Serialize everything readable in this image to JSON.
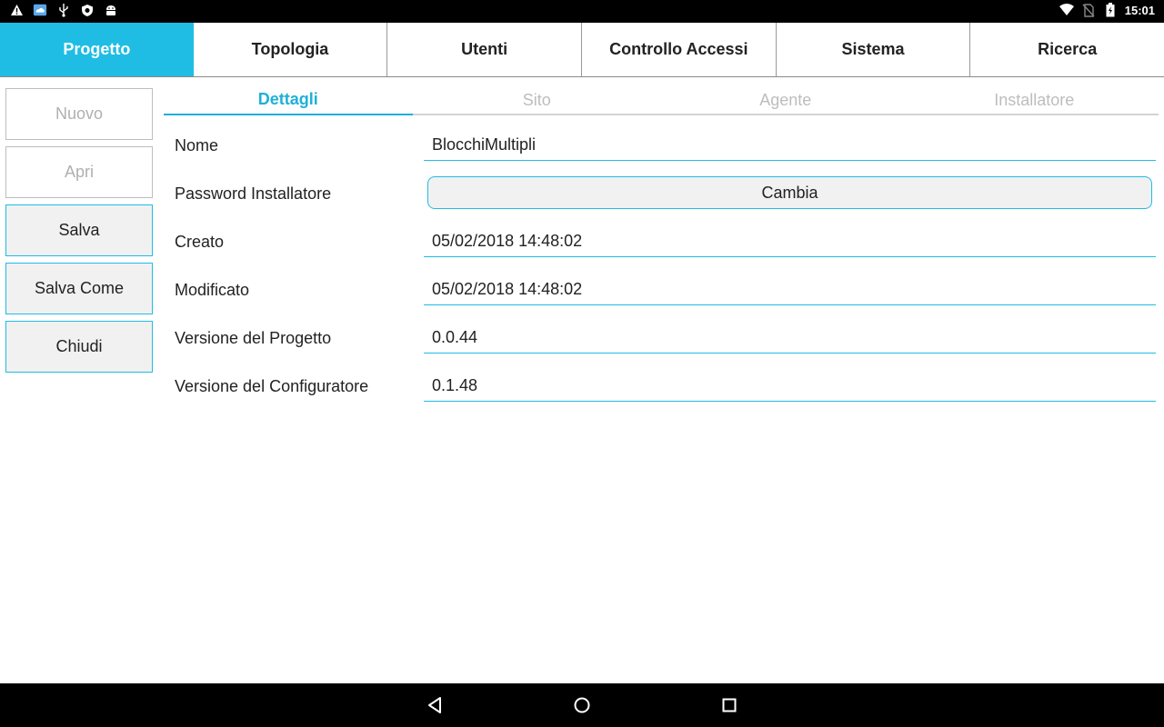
{
  "status_bar": {
    "left_icons": [
      "warning-icon",
      "cloud-app-icon",
      "usb-icon",
      "shield-icon",
      "android-icon"
    ],
    "right_icons": [
      "wifi-icon",
      "no-sim-icon",
      "battery-charging-icon"
    ],
    "time": "15:01"
  },
  "top_tabs": [
    {
      "label": "Progetto",
      "active": true
    },
    {
      "label": "Topologia",
      "active": false
    },
    {
      "label": "Utenti",
      "active": false
    },
    {
      "label": "Controllo Accessi",
      "active": false
    },
    {
      "label": "Sistema",
      "active": false
    },
    {
      "label": "Ricerca",
      "active": false
    }
  ],
  "sidebar": {
    "buttons": [
      {
        "label": "Nuovo",
        "enabled": false
      },
      {
        "label": "Apri",
        "enabled": false
      },
      {
        "label": "Salva",
        "enabled": true
      },
      {
        "label": "Salva Come",
        "enabled": true
      },
      {
        "label": "Chiudi",
        "enabled": true
      }
    ]
  },
  "sub_tabs": [
    {
      "label": "Dettagli",
      "active": true
    },
    {
      "label": "Sito",
      "active": false
    },
    {
      "label": "Agente",
      "active": false
    },
    {
      "label": "Installatore",
      "active": false
    }
  ],
  "form": {
    "nome": {
      "label": "Nome",
      "value": "BlocchiMultipli"
    },
    "password": {
      "label": "Password Installatore",
      "button": "Cambia"
    },
    "creato": {
      "label": "Creato",
      "value": "05/02/2018 14:48:02"
    },
    "modificato": {
      "label": "Modificato",
      "value": "05/02/2018 14:48:02"
    },
    "versione_progetto": {
      "label": "Versione del Progetto",
      "value": "0.0.44"
    },
    "versione_configuratore": {
      "label": "Versione del Configuratore",
      "value": "0.1.48"
    }
  },
  "nav_bar": {
    "buttons": [
      "back-icon",
      "home-icon",
      "recents-icon"
    ]
  },
  "colors": {
    "accent": "#1fbde4",
    "status_bar": "#000000",
    "nav_bar": "#000000",
    "disabled_text": "#b0b0b0"
  }
}
